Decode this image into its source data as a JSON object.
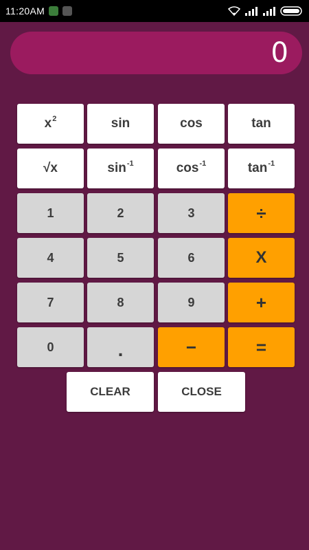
{
  "status_bar": {
    "time": "11:20AM",
    "icons": [
      "notification-app-icon",
      "notification-app-icon",
      "wifi-icon",
      "signal-icon",
      "signal-icon",
      "battery-icon"
    ]
  },
  "display": {
    "value": "0"
  },
  "scientific": {
    "square": {
      "base": "x",
      "sup": "2"
    },
    "sin": "sin",
    "cos": "cos",
    "tan": "tan",
    "sqrt": "√x",
    "asin": {
      "base": "sin",
      "sup": "-1"
    },
    "acos": {
      "base": "cos",
      "sup": "-1"
    },
    "atan": {
      "base": "tan",
      "sup": "-1"
    }
  },
  "digits": {
    "d1": "1",
    "d2": "2",
    "d3": "3",
    "d4": "4",
    "d5": "5",
    "d6": "6",
    "d7": "7",
    "d8": "8",
    "d9": "9",
    "d0": "0",
    "dot": "."
  },
  "operators": {
    "divide": "÷",
    "multiply": "X",
    "add": "+",
    "subtract": "−",
    "equals": "="
  },
  "actions": {
    "clear": "CLEAR",
    "close": "CLOSE"
  },
  "colors": {
    "background": "#611945",
    "display": "#9b1b5f",
    "function_key": "#ffffff",
    "number_key": "#d6d6d6",
    "operator_key": "#ffa000"
  }
}
